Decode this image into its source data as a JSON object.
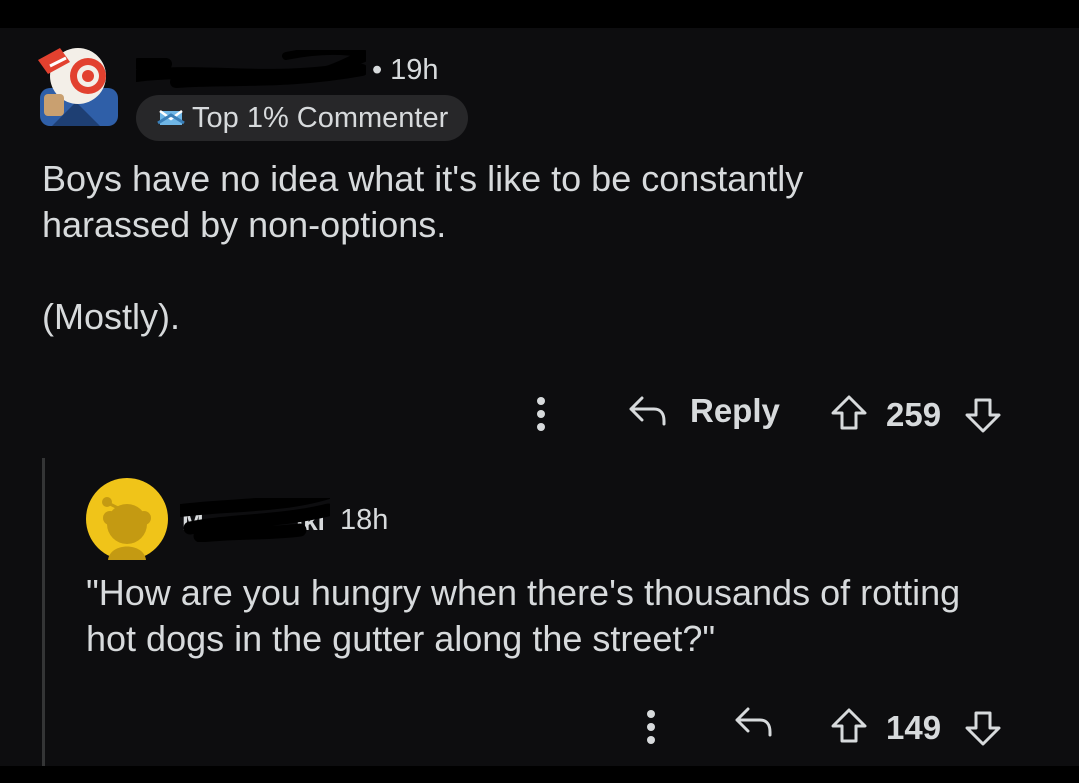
{
  "comment": {
    "username": "",
    "time": "19h",
    "separator": "•",
    "badge_label": "Top 1% Commenter",
    "avatar_icon": "reddit-avatar",
    "body": [
      "Boys have no idea what it's like to be constantly harassed by non-options.",
      "(Mostly)."
    ],
    "actions": {
      "more_icon": "kebab-icon",
      "reply_label": "Reply",
      "score": "259"
    }
  },
  "reply": {
    "username_visible_fragment": "M  iki",
    "time": "18h",
    "avatar_icon": "snoo-avatar",
    "avatar_color": "#f0c419",
    "body": [
      "\"How are you hungry when there's thousands of rotting hot dogs in the gutter along the street?\""
    ],
    "actions": {
      "more_icon": "kebab-icon",
      "score": "149"
    }
  },
  "colors": {
    "background": "#0d0d0f",
    "text": "#d7dadc",
    "badge_bg": "#272729",
    "thread_line": "#343536"
  }
}
